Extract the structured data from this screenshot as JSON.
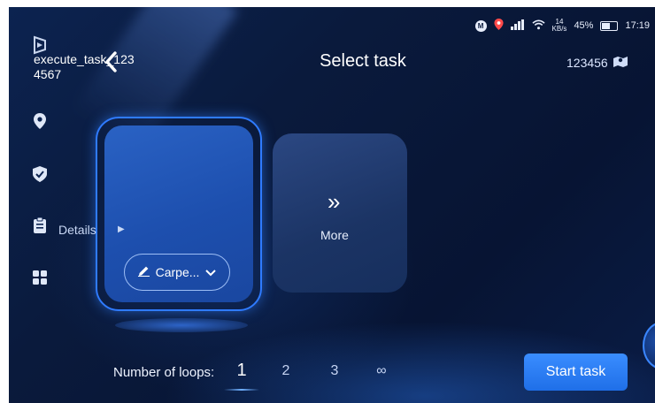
{
  "status_bar": {
    "m_badge": "M",
    "net_speed_value": "14",
    "net_speed_unit": "KB/s",
    "battery": "45%",
    "time": "17:19"
  },
  "header": {
    "title": "Select task",
    "robot_id": "123456"
  },
  "task_card": {
    "name": "execute_task_1234567",
    "details_label": "Details",
    "mode_label": "Carpe..."
  },
  "more_card": {
    "label": "More"
  },
  "loops": {
    "label": "Number of loops:",
    "options": [
      "1",
      "2",
      "3",
      "∞"
    ],
    "selected": "1"
  },
  "actions": {
    "start_label": "Start task"
  },
  "colors": {
    "accent": "#2f7bff",
    "button": "#2a7df5",
    "background": "#0a1a3c"
  }
}
